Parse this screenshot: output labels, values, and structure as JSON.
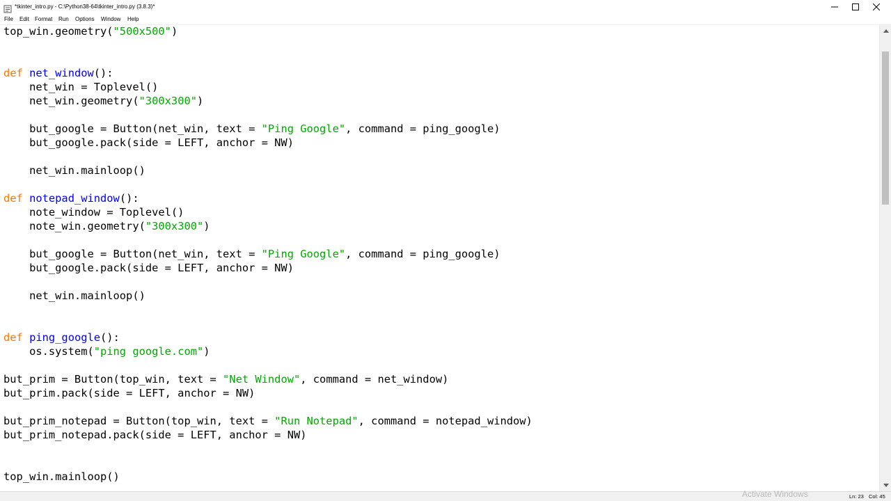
{
  "window": {
    "title": "*tkinter_intro.py - C:\\Python38-64\\tkinter_intro.py (3.8.3)*",
    "app_icon": "python-idle-icon",
    "controls": {
      "minimize_icon": "minimize-icon",
      "maximize_icon": "maximize-icon",
      "close_icon": "close-icon"
    }
  },
  "menu": {
    "items": [
      "File",
      "Edit",
      "Format",
      "Run",
      "Options",
      "Window",
      "Help"
    ]
  },
  "editor": {
    "colors": {
      "keyword": "#ff7700",
      "definition": "#0000ff",
      "string": "#00aa00",
      "text": "#000000"
    },
    "lines": [
      [
        {
          "t": "top_win.geometry("
        },
        {
          "t": "\"500x500\"",
          "c": "str"
        },
        {
          "t": ")"
        }
      ],
      [],
      [],
      [
        {
          "t": "def",
          "c": "kw"
        },
        {
          "t": " "
        },
        {
          "t": "net_window",
          "c": "defname"
        },
        {
          "t": "():"
        }
      ],
      [
        {
          "t": "    net_win = Toplevel()"
        }
      ],
      [
        {
          "t": "    net_win.geometry("
        },
        {
          "t": "\"300x300\"",
          "c": "str"
        },
        {
          "t": ")"
        }
      ],
      [],
      [
        {
          "t": "    but_google = Button(net_win, text = "
        },
        {
          "t": "\"Ping Google\"",
          "c": "str"
        },
        {
          "t": ", command = ping_google)"
        }
      ],
      [
        {
          "t": "    but_google.pack(side = LEFT, anchor = NW)"
        }
      ],
      [],
      [
        {
          "t": "    net_win.mainloop()"
        }
      ],
      [],
      [
        {
          "t": "def",
          "c": "kw"
        },
        {
          "t": " "
        },
        {
          "t": "notepad_window",
          "c": "defname"
        },
        {
          "t": "():"
        }
      ],
      [
        {
          "t": "    note_window = Toplevel()"
        }
      ],
      [
        {
          "t": "    note_win.geometry("
        },
        {
          "t": "\"300x300\"",
          "c": "str"
        },
        {
          "t": ")"
        }
      ],
      [],
      [
        {
          "t": "    but_google = Button(net_win, text = "
        },
        {
          "t": "\"Ping Google\"",
          "c": "str"
        },
        {
          "t": ", command = ping_google)"
        }
      ],
      [
        {
          "t": "    but_google.pack(side = LEFT, anchor = NW)"
        }
      ],
      [],
      [
        {
          "t": "    net_win.mainloop()"
        }
      ],
      [],
      [],
      [
        {
          "t": "def",
          "c": "kw"
        },
        {
          "t": " "
        },
        {
          "t": "ping_google",
          "c": "defname"
        },
        {
          "t": "():"
        }
      ],
      [
        {
          "t": "    os.system("
        },
        {
          "t": "\"ping google.com\"",
          "c": "str"
        },
        {
          "t": ")"
        }
      ],
      [],
      [
        {
          "t": "but_prim = Button(top_win, text = "
        },
        {
          "t": "\"Net Window\"",
          "c": "str"
        },
        {
          "t": ", command = net_window)"
        }
      ],
      [
        {
          "t": "but_prim.pack(side = LEFT, anchor = NW)"
        }
      ],
      [],
      [
        {
          "t": "but_prim_notepad = Button(top_win, text = "
        },
        {
          "t": "\"Run Notepad\"",
          "c": "str"
        },
        {
          "t": ", command = notepad_window)"
        }
      ],
      [
        {
          "t": "but_prim_notepad.pack(side = LEFT, anchor = NW)"
        }
      ],
      [],
      [],
      [
        {
          "t": "top_win.mainloop()"
        }
      ]
    ]
  },
  "scrollbar": {
    "up_icon": "scroll-up-arrow-icon",
    "down_icon": "scroll-down-arrow-icon"
  },
  "status": {
    "line": "Ln: 23",
    "col": "Col: 45"
  },
  "watermark": "Activate Windows"
}
